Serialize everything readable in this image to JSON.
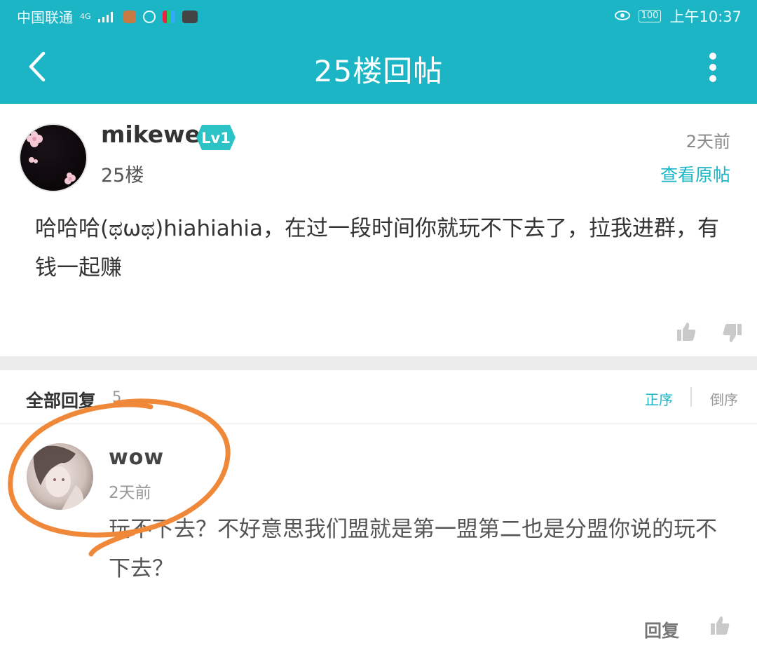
{
  "status_bar": {
    "carrier": "中国联通",
    "network": "4G",
    "battery": "100",
    "time": "上午10:37"
  },
  "header": {
    "title": "25楼回帖",
    "back_icon": "chevron-left-icon",
    "more_icon": "more-vertical-icon"
  },
  "post": {
    "username": "mikewe",
    "level": "Lv1",
    "floor": "25楼",
    "time": "2天前",
    "view_original": "查看原帖",
    "content": "哈哈哈(ಥωಥ)hiahiahia，在过一段时间你就玩不下去了，拉我进群，有钱一起赚"
  },
  "replies": {
    "header": "全部回复",
    "count": "5",
    "sort_asc": "正序",
    "sort_desc": "倒序",
    "items": [
      {
        "username": "wow",
        "time": "2天前",
        "content": "玩不下去？不好意思我们盟就是第一盟第二也是分盟你说的玩不下去？",
        "reply_label": "回复"
      }
    ]
  },
  "colors": {
    "accent": "#1cb5c5",
    "annotation": "#f0883a"
  }
}
